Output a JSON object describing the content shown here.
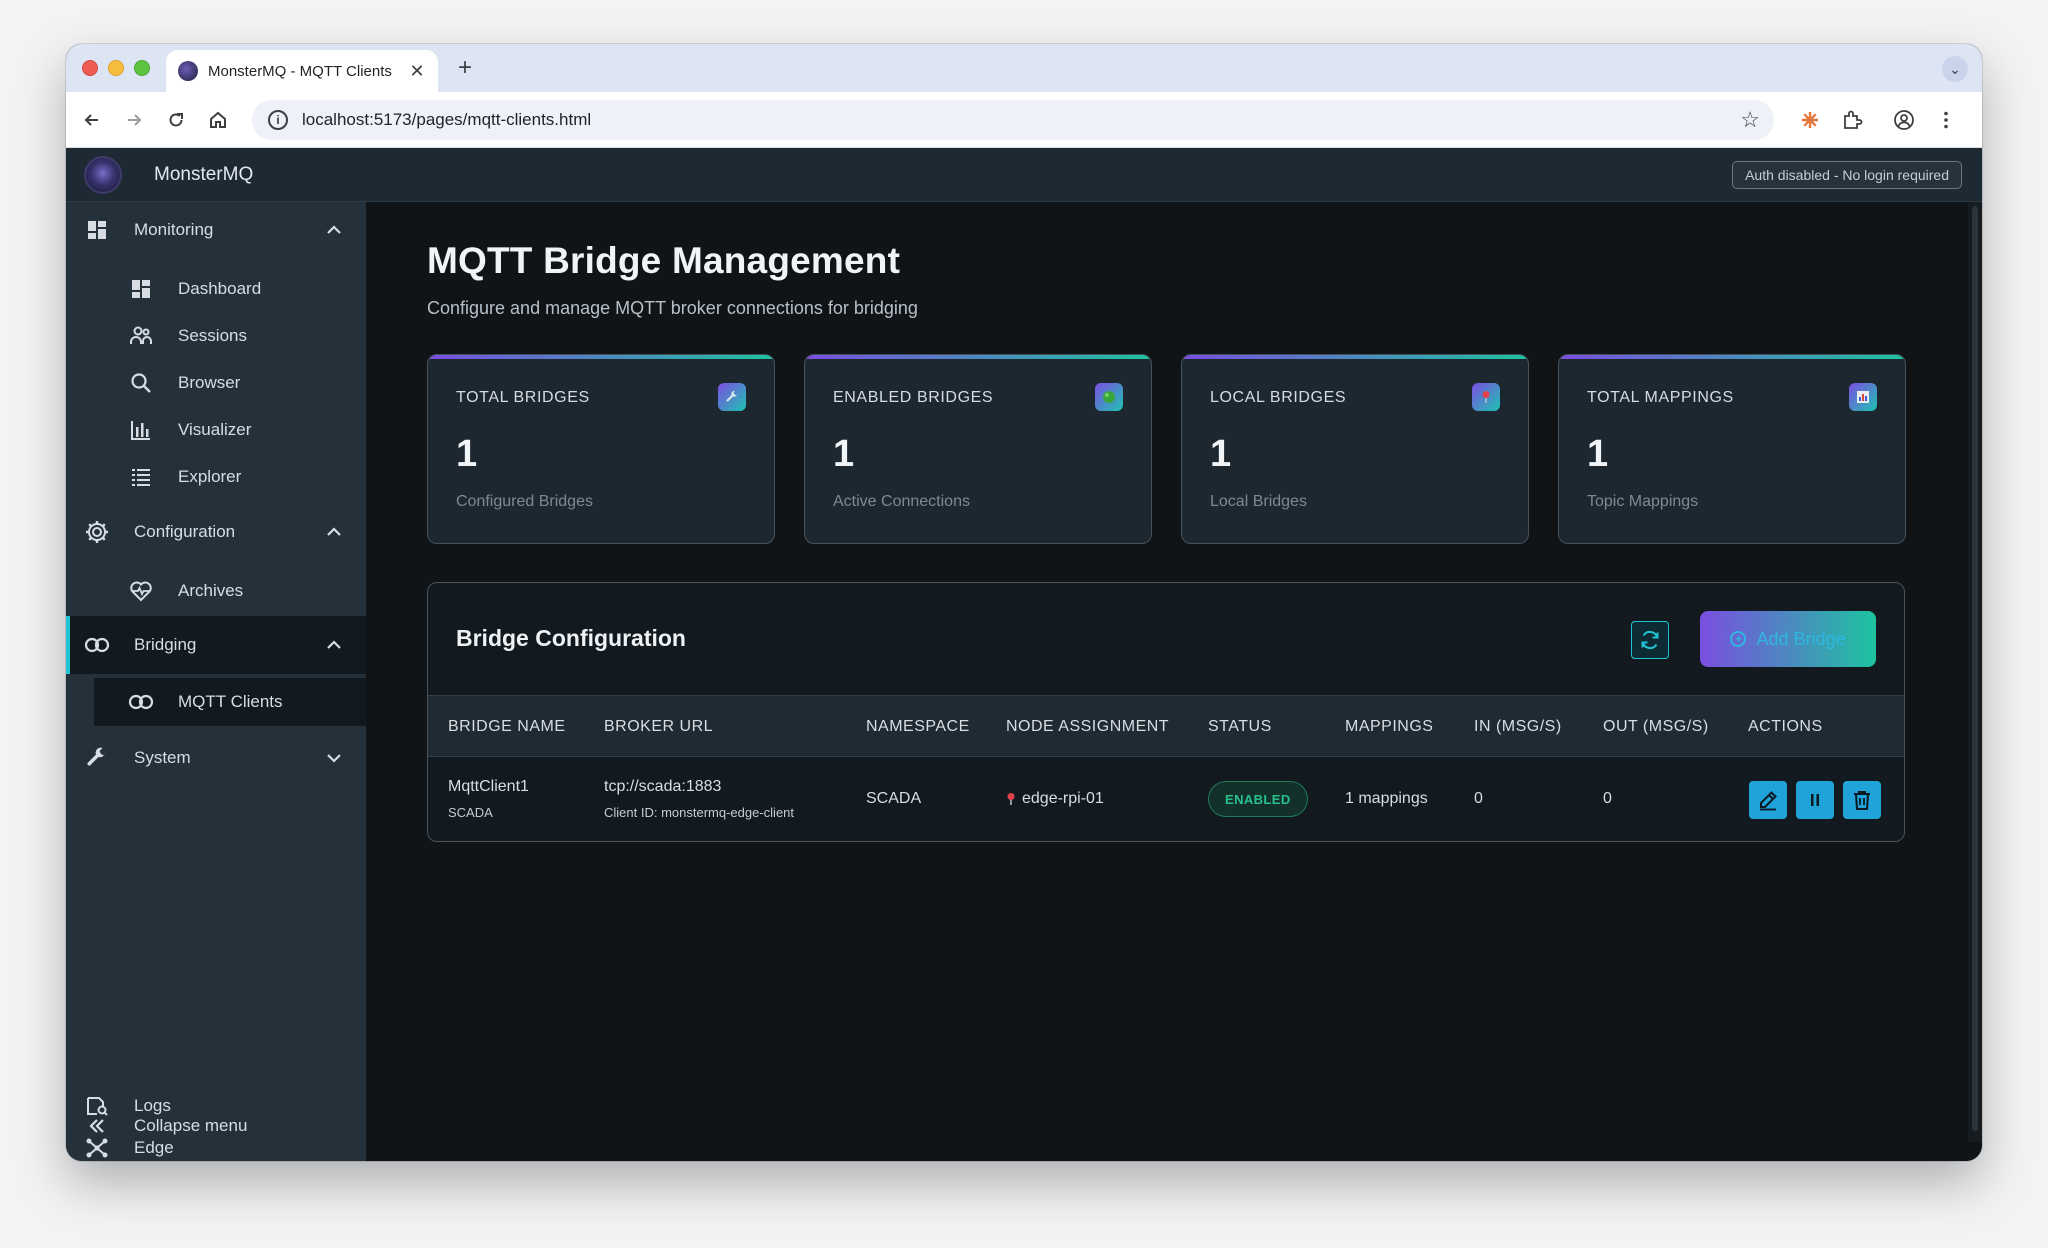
{
  "browser": {
    "tab_title": "MonsterMQ - MQTT Clients",
    "url": "localhost:5173/pages/mqtt-clients.html"
  },
  "app": {
    "title": "MonsterMQ",
    "auth_badge": "Auth disabled - No login required"
  },
  "sidebar": {
    "groups": [
      {
        "label": "Monitoring",
        "items": [
          "Dashboard",
          "Sessions",
          "Browser",
          "Visualizer",
          "Explorer"
        ]
      },
      {
        "label": "Configuration",
        "items": [
          "Archives"
        ]
      },
      {
        "label": "Bridging",
        "items": [
          "MQTT Clients"
        ]
      },
      {
        "label": "System",
        "items": []
      }
    ],
    "bottom": [
      "Logs",
      "Edge",
      "Collapse menu"
    ]
  },
  "page": {
    "title": "MQTT Bridge Management",
    "subtitle": "Configure and manage MQTT broker connections for bridging"
  },
  "stats": [
    {
      "label": "TOTAL BRIDGES",
      "value": "1",
      "desc": "Configured Bridges",
      "icon": "wrench-icon"
    },
    {
      "label": "ENABLED BRIDGES",
      "value": "1",
      "desc": "Active Connections",
      "icon": "green-circle-icon"
    },
    {
      "label": "LOCAL BRIDGES",
      "value": "1",
      "desc": "Local Bridges",
      "icon": "pin-icon"
    },
    {
      "label": "TOTAL MAPPINGS",
      "value": "1",
      "desc": "Topic Mappings",
      "icon": "chart-icon"
    }
  ],
  "panel": {
    "title": "Bridge Configuration",
    "add_label": "Add Bridge"
  },
  "table": {
    "headers": [
      "BRIDGE NAME",
      "BROKER URL",
      "NAMESPACE",
      "NODE ASSIGNMENT",
      "STATUS",
      "MAPPINGS",
      "IN (MSG/S)",
      "OUT (MSG/S)",
      "ACTIONS"
    ],
    "rows": [
      {
        "name": "MqttClient1",
        "name_sub": "SCADA",
        "broker_url": "tcp://scada:1883",
        "client_id": "Client ID: monstermq-edge-client",
        "namespace": "SCADA",
        "node": "edge-rpi-01",
        "status": "ENABLED",
        "mappings": "1 mappings",
        "in": "0",
        "out": "0"
      }
    ]
  },
  "colors": {
    "accent_purple": "#7a4fe0",
    "accent_teal": "#1ec3a0",
    "action_blue": "#1fa3d9",
    "status_green": "#28c08a"
  }
}
